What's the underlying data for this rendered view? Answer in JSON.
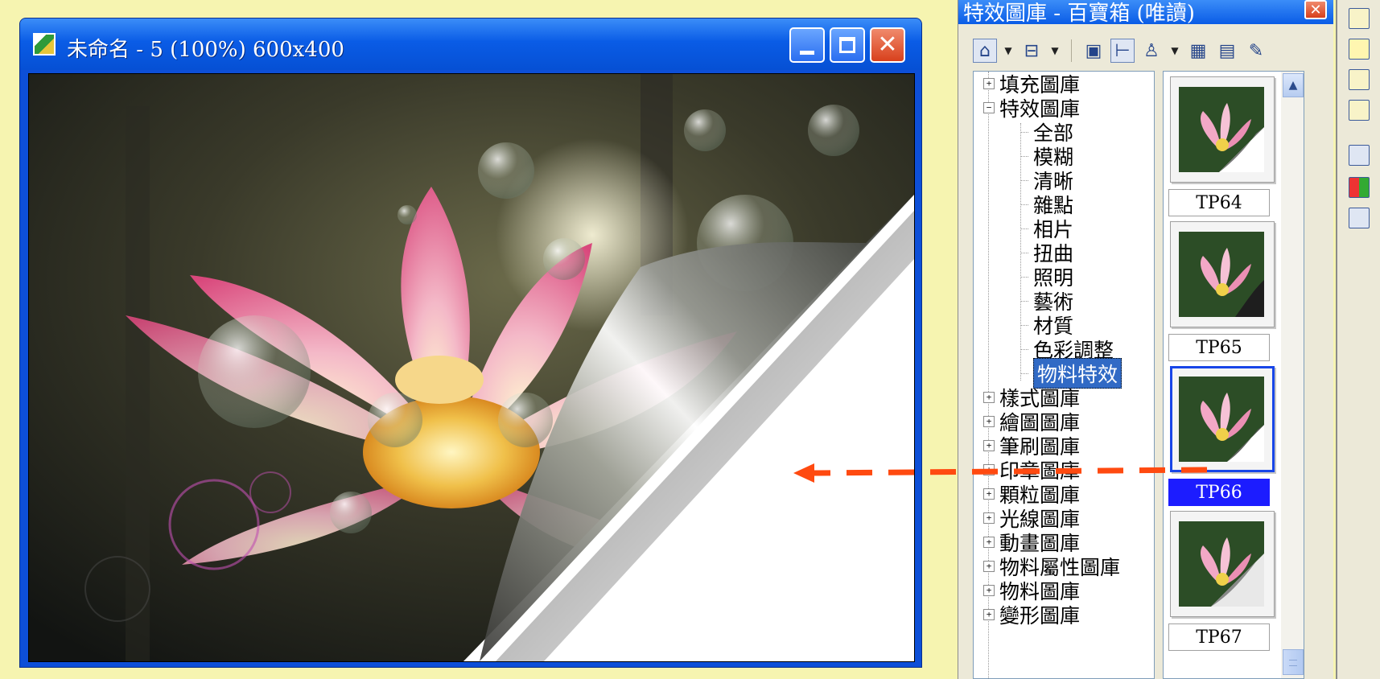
{
  "document_window": {
    "title": "未命名 - 5 (100%) 600x400"
  },
  "library_panel": {
    "title": "特效圖庫 - 百寶箱 (唯讀)",
    "toolbar_icons": [
      "library-icon",
      "dropdown-arrow-icon",
      "storage-icon",
      "dropdown-arrow-icon",
      "image-icon",
      "tree-view-icon",
      "stamp-icon",
      "dropdown-arrow-icon",
      "grid-view-icon",
      "details-view-icon",
      "edit-icon"
    ],
    "tree": {
      "categories_top": [
        {
          "label": "填充圖庫",
          "expander": "+"
        },
        {
          "label": "特效圖庫",
          "expander": "−"
        }
      ],
      "children": [
        "全部",
        "模糊",
        "清晰",
        "雜點",
        "相片",
        "扭曲",
        "照明",
        "藝術",
        "材質",
        "色彩調整",
        "物料特效"
      ],
      "selected_child": "物料特效",
      "categories_bottom": [
        "樣式圖庫",
        "繪圖圖庫",
        "筆刷圖庫",
        "印章圖庫",
        "顆粒圖庫",
        "光線圖庫",
        "動畫圖庫",
        "物料屬性圖庫",
        "物料圖庫",
        "變形圖庫"
      ]
    },
    "thumbnails": [
      {
        "label": "TP64",
        "selected": false
      },
      {
        "label": "TP65",
        "selected": false
      },
      {
        "label": "TP66",
        "selected": true
      },
      {
        "label": "TP67",
        "selected": false
      }
    ]
  },
  "colors": {
    "background": "#f6f4b0",
    "titlebar": "#0a5ce6",
    "selection": "#316ac5",
    "arrow": "#ff4a10"
  }
}
